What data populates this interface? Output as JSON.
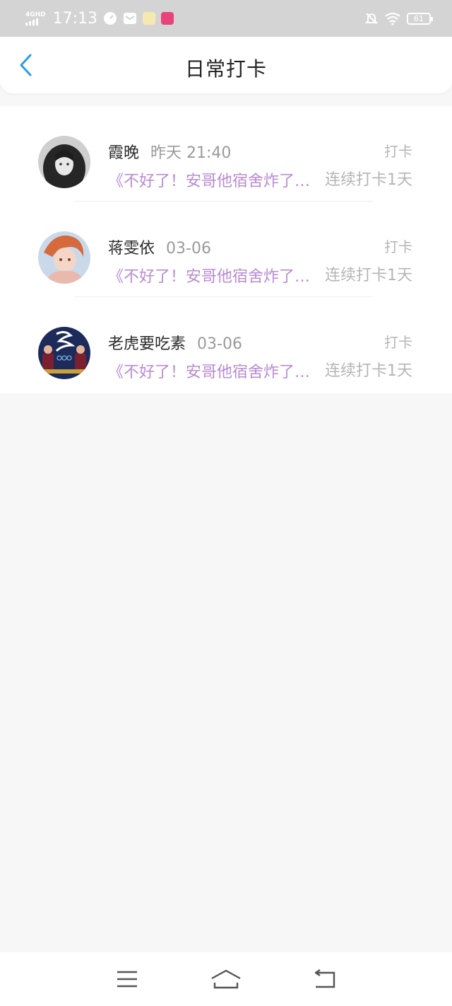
{
  "status_bar": {
    "network": "4GHD",
    "time": "17:13",
    "battery": "61"
  },
  "header": {
    "title": "日常打卡",
    "back_icon": "chevron-left-icon"
  },
  "items": [
    {
      "name": "霞晚",
      "time": "昨天 21:40",
      "action": "打卡",
      "content": "《不好了！安哥他宿舍炸了…",
      "streak": "连续打卡1天"
    },
    {
      "name": "蒋雯依",
      "time": "03-06",
      "action": "打卡",
      "content": "《不好了！安哥他宿舍炸了…",
      "streak": "连续打卡1天"
    },
    {
      "name": "老虎要吃素",
      "time": "03-06",
      "action": "打卡",
      "content": "《不好了！安哥他宿舍炸了…",
      "streak": "连续打卡1天"
    }
  ],
  "nav_bar": {
    "icons": [
      "menu-icon",
      "home-icon",
      "back-icon"
    ]
  },
  "colors": {
    "accent": "#2a9de4",
    "content": "#b98ad3",
    "muted": "#b5b5b5"
  }
}
